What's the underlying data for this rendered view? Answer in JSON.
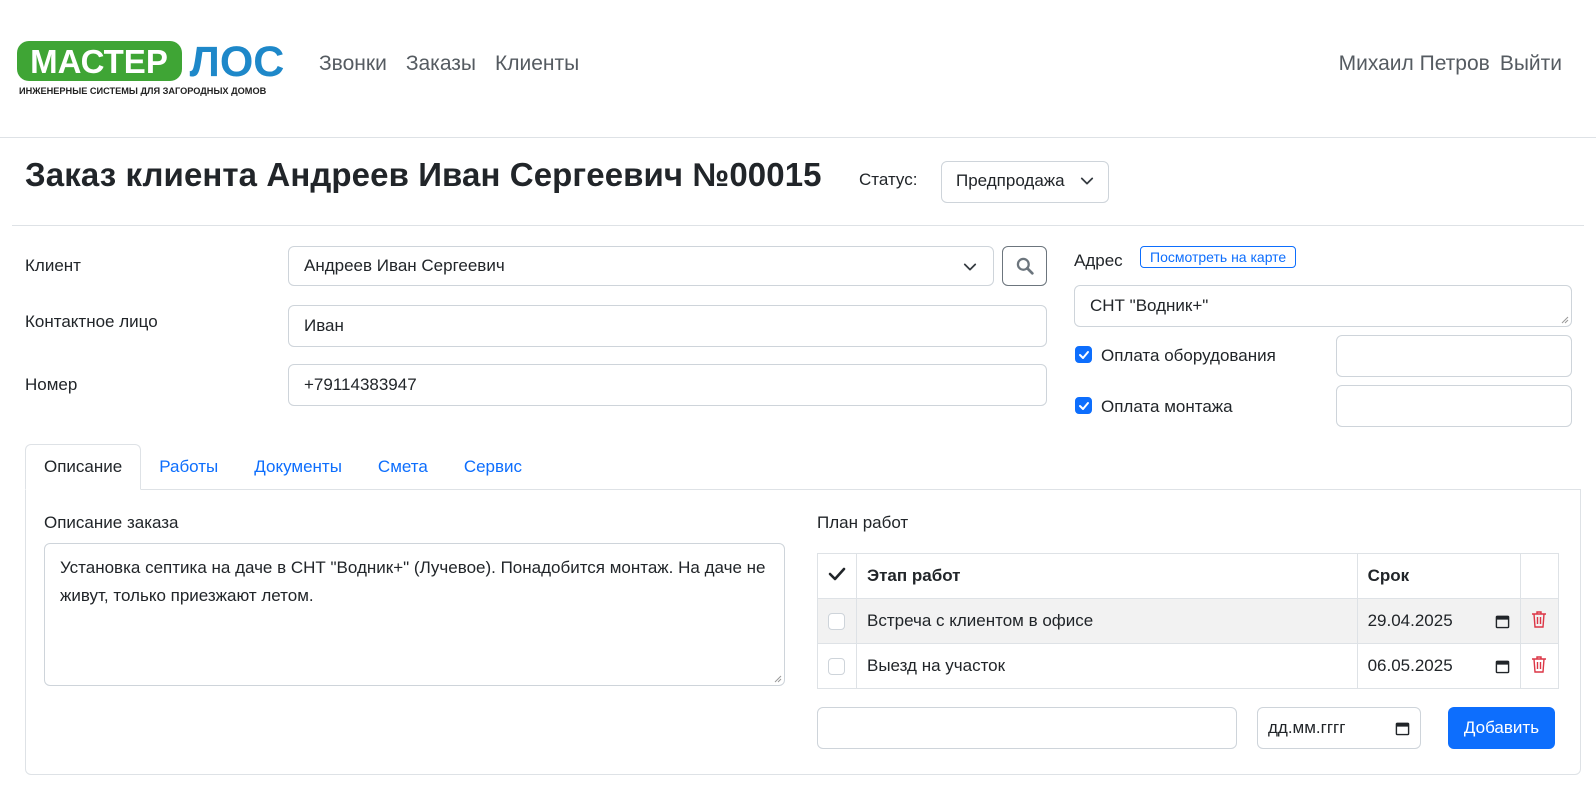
{
  "brand": {
    "logo_part1": "МАСТЕР",
    "logo_part2": "ЛОС",
    "logo_tagline": "ИНЖЕНЕРНЫЕ СИСТЕМЫ ДЛЯ ЗАГОРОДНЫХ ДОМОВ",
    "green": "#3fa535",
    "blue": "#1e88c9"
  },
  "nav": {
    "items": [
      {
        "label": "Звонки"
      },
      {
        "label": "Заказы"
      },
      {
        "label": "Клиенты"
      }
    ],
    "user_name": "Михаил Петров",
    "logout": "Выйти"
  },
  "header": {
    "title": "Заказ клиента Андреев Иван Сергеевич №00015",
    "status_label": "Статус:",
    "status_value": "Предпродажа"
  },
  "form": {
    "client_label": "Клиент",
    "client_value": "Андреев Иван Сергеевич",
    "contact_label": "Контактное лицо",
    "contact_value": "Иван",
    "phone_label": "Номер",
    "phone_value": "+79114383947",
    "address_label": "Адрес",
    "map_button": "Посмотреть на карте",
    "address_value": "СНТ \"Водник+\"",
    "equipment_payment_label": "Оплата оборудования",
    "equipment_payment_checked": true,
    "equipment_payment_value": "",
    "install_payment_label": "Оплата монтажа",
    "install_payment_checked": true,
    "install_payment_value": ""
  },
  "tabs": [
    {
      "label": "Описание",
      "active": true
    },
    {
      "label": "Работы",
      "active": false
    },
    {
      "label": "Документы",
      "active": false
    },
    {
      "label": "Смета",
      "active": false
    },
    {
      "label": "Сервис",
      "active": false
    }
  ],
  "description": {
    "label": "Описание заказа",
    "text": "Установка септика на даче в СНТ \"Водник+\" (Лучевое). Понадобится монтаж. На даче не живут, только приезжают летом."
  },
  "plan": {
    "label": "План работ",
    "col_stage": "Этап работ",
    "col_deadline": "Срок",
    "rows": [
      {
        "stage": "Встреча с клиентом в офисе",
        "deadline": "29.04.2025",
        "done": false
      },
      {
        "stage": "Выезд на участок",
        "deadline": "06.05.2025",
        "done": false
      }
    ],
    "new_stage_value": "",
    "new_date_placeholder": "дд.мм.гггг",
    "add_button": "Добавить"
  },
  "colors": {
    "primary": "#0d6efd",
    "danger": "#dc3545",
    "border": "#dee2e6"
  },
  "icons": [
    "search-icon",
    "chevron-down-icon",
    "check-icon",
    "calendar-icon",
    "trash-icon"
  ]
}
